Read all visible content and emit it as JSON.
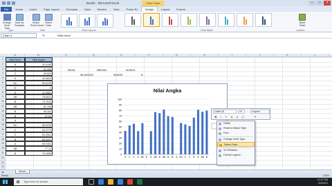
{
  "window": {
    "title": "Book2 - Microsoft Excel",
    "chart_tools_label": "Chart Tools",
    "controls": [
      "–",
      "□",
      "×"
    ]
  },
  "ribbon": {
    "tabs": [
      "File",
      "Home",
      "Insert",
      "Page Layout",
      "Formulas",
      "Data",
      "Review",
      "View",
      "Power BI",
      "Design",
      "Layout",
      "Format"
    ],
    "active_tab": "Design",
    "buttons": {
      "change_type": "Change Chart Type",
      "save_template": "Save As Template",
      "switch_row": "Switch Row/Column",
      "select_data": "Select Data",
      "move_chart": "Move Chart"
    },
    "groups": {
      "type": "Type",
      "data": "Data",
      "layouts": "Chart Layouts",
      "styles": "Chart Styles",
      "location": "Location"
    }
  },
  "formula_bar": {
    "name_box": "Chart 4",
    "fx": "fx",
    "formula": "Nilai Huruf"
  },
  "columns": [
    "A",
    "B",
    "C",
    "D",
    "E",
    "F",
    "G",
    "H",
    "I",
    "J",
    "K",
    "L"
  ],
  "rows": [
    "1",
    "2",
    "3",
    "4",
    "5",
    "6",
    "7",
    "8",
    "9",
    "10",
    "11",
    "12",
    "13",
    "14",
    "15",
    "16",
    "17",
    "18",
    "19",
    "20",
    "21",
    "22",
    "23",
    "24"
  ],
  "table": {
    "headers": [
      "Nilai Huruf",
      "Nilai Angka"
    ],
    "rows": [
      [
        "H",
        "42.4195"
      ],
      [
        "C",
        "52.395"
      ],
      [
        "C",
        "55.529"
      ],
      [
        "H",
        "42.0822"
      ],
      [
        "BC",
        "56.6239"
      ],
      [
        "E",
        "0"
      ],
      [
        "D",
        "41.9681"
      ],
      [
        "AB",
        "76.6031"
      ],
      [
        "B",
        "74.7515"
      ],
      [
        "AB",
        "81.108"
      ],
      [
        "B",
        "99.303"
      ],
      [
        "B",
        "67.81"
      ],
      [
        "A",
        ""
      ],
      [
        "BC",
        "56.9225"
      ],
      [
        "C",
        "54.2775"
      ],
      [
        "C",
        "51.2951"
      ],
      [
        "B",
        "66.6291"
      ],
      [
        "A",
        "80.9161"
      ],
      [
        "AB",
        "77.14"
      ],
      [
        "B",
        "79.1895"
      ]
    ]
  },
  "stats": {
    "mean_label": "MEAN",
    "median_label": "MEDIAN",
    "modus_label": "MODUS",
    "mean_value": "58.4053333",
    "median_value": "58.6095",
    "modus_value": "B"
  },
  "chart_data": {
    "type": "bar",
    "title": "Nilai Angka",
    "categories": [
      "H",
      "C",
      "C",
      "H",
      "BC",
      "E",
      "D",
      "AB",
      "B",
      "AB",
      "B",
      "B",
      "A",
      "BC",
      "C",
      "C",
      "B",
      "A",
      "AB",
      "B"
    ],
    "values": [
      42.4,
      52.4,
      55.5,
      42.1,
      56.6,
      0,
      42.0,
      76.6,
      74.8,
      81.1,
      69.3,
      67.8,
      0,
      56.9,
      54.3,
      51.3,
      66.6,
      80.9,
      77.1,
      79.2
    ],
    "ylim": [
      0,
      100
    ],
    "yticks": [
      0,
      10,
      20,
      30,
      40,
      50,
      60,
      70,
      80,
      90,
      100
    ],
    "bar_color": "#4472c4",
    "grid": true
  },
  "minibar": {
    "font": "Calibri (E",
    "size": "10",
    "legend": "Legend"
  },
  "context_menu": [
    {
      "label": "Delete",
      "icon": "delete-icon"
    },
    {
      "label": "Reset to Match Style",
      "icon": "reset-icon"
    },
    {
      "label": "Font...",
      "icon": "font-icon"
    },
    {
      "label": "Change Chart Type...",
      "icon": "chart-type-icon"
    },
    {
      "label": "Select Data...",
      "icon": "select-data-icon",
      "highlighted": true
    },
    {
      "label": "3-D Rotation...",
      "icon": "rotation-icon"
    },
    {
      "label": "Format Legend...",
      "icon": "format-icon"
    }
  ],
  "sheet": {
    "tab": "Sheet1",
    "status": "Ready",
    "zoom": "100%"
  },
  "taskbar": {
    "search_placeholder": "Type here to search",
    "time": "10:27 PM",
    "date": "9/4/2021"
  }
}
